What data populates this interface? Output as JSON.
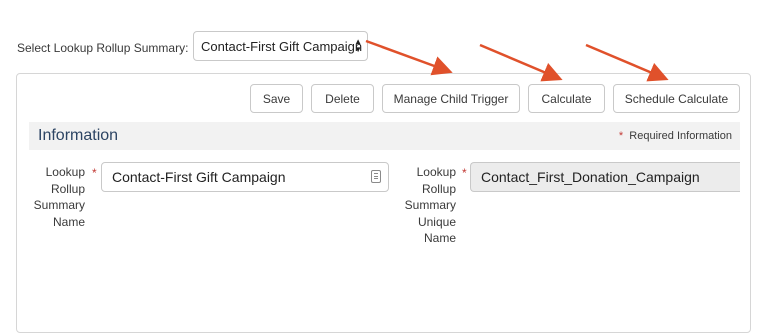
{
  "selector": {
    "label": "Select Lookup Rollup Summary:",
    "selected": "Contact-First Gift Campaign"
  },
  "toolbar": {
    "save": "Save",
    "delete": "Delete",
    "manage_child_trigger": "Manage Child Trigger",
    "calculate": "Calculate",
    "schedule_calculate": "Schedule Calculate"
  },
  "section": {
    "title": "Information",
    "required_star": "*",
    "required_text": "Required Information"
  },
  "fields": {
    "name": {
      "label_lines": [
        "Lookup",
        "Rollup",
        "Summary",
        "Name"
      ],
      "value": "Contact-First Gift Campaign",
      "required": "*"
    },
    "unique_name": {
      "label_lines": [
        "Lookup",
        "Rollup",
        "Summary",
        "Unique",
        "Name"
      ],
      "value": "Contact_First_Donation_Campaign",
      "required": "*"
    }
  },
  "colors": {
    "arrow": "#e0512b",
    "required": "#c23934",
    "section_title": "#2c4463",
    "section_bg": "#f2f2f2"
  }
}
